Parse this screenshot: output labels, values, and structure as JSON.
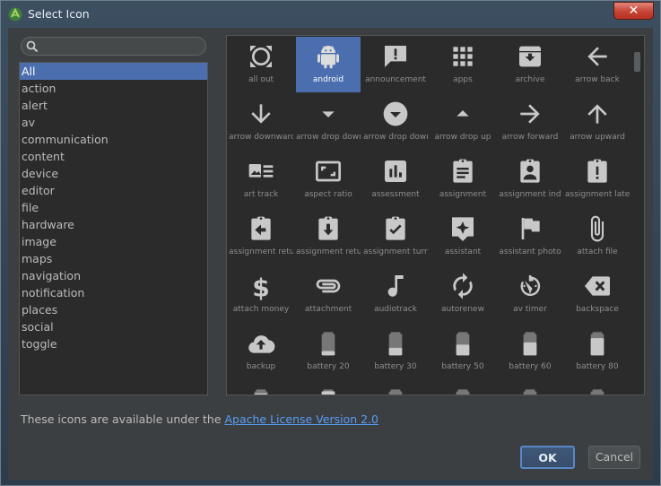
{
  "window": {
    "title": "Select Icon",
    "close_label": "✕",
    "app_icon": "android-studio-icon"
  },
  "search": {
    "value": "",
    "placeholder": ""
  },
  "categories": [
    "All",
    "action",
    "alert",
    "av",
    "communication",
    "content",
    "device",
    "editor",
    "file",
    "hardware",
    "image",
    "maps",
    "navigation",
    "notification",
    "places",
    "social",
    "toggle"
  ],
  "selected_category": "All",
  "icons": [
    {
      "label": "all out",
      "icon": "all-out-icon"
    },
    {
      "label": "android",
      "icon": "android-icon",
      "selected": true
    },
    {
      "label": "announcement",
      "icon": "announcement-icon"
    },
    {
      "label": "apps",
      "icon": "apps-icon"
    },
    {
      "label": "archive",
      "icon": "archive-icon"
    },
    {
      "label": "arrow back",
      "icon": "arrow-back-icon"
    },
    {
      "label": "arrow downward",
      "icon": "arrow-downward-icon"
    },
    {
      "label": "arrow drop down",
      "icon": "arrow-drop-down-icon"
    },
    {
      "label": "arrow drop down circle",
      "icon": "arrow-drop-down-circle-icon"
    },
    {
      "label": "arrow drop up",
      "icon": "arrow-drop-up-icon"
    },
    {
      "label": "arrow forward",
      "icon": "arrow-forward-icon"
    },
    {
      "label": "arrow upward",
      "icon": "arrow-upward-icon"
    },
    {
      "label": "art track",
      "icon": "art-track-icon"
    },
    {
      "label": "aspect ratio",
      "icon": "aspect-ratio-icon"
    },
    {
      "label": "assessment",
      "icon": "assessment-icon"
    },
    {
      "label": "assignment",
      "icon": "assignment-icon"
    },
    {
      "label": "assignment ind",
      "icon": "assignment-ind-icon"
    },
    {
      "label": "assignment late",
      "icon": "assignment-late-icon"
    },
    {
      "label": "assignment return",
      "icon": "assignment-return-icon"
    },
    {
      "label": "assignment returned",
      "icon": "assignment-returned-icon"
    },
    {
      "label": "assignment turned in",
      "icon": "assignment-turned-in-icon"
    },
    {
      "label": "assistant",
      "icon": "assistant-icon"
    },
    {
      "label": "assistant photo",
      "icon": "assistant-photo-icon"
    },
    {
      "label": "attach file",
      "icon": "attach-file-icon"
    },
    {
      "label": "attach money",
      "icon": "attach-money-icon"
    },
    {
      "label": "attachment",
      "icon": "attachment-icon"
    },
    {
      "label": "audiotrack",
      "icon": "audiotrack-icon"
    },
    {
      "label": "autorenew",
      "icon": "autorenew-icon"
    },
    {
      "label": "av timer",
      "icon": "av-timer-icon"
    },
    {
      "label": "backspace",
      "icon": "backspace-icon"
    },
    {
      "label": "backup",
      "icon": "backup-icon"
    },
    {
      "label": "battery 20",
      "icon": "battery-20-icon"
    },
    {
      "label": "battery 30",
      "icon": "battery-30-icon"
    },
    {
      "label": "battery 50",
      "icon": "battery-50-icon"
    },
    {
      "label": "battery 60",
      "icon": "battery-60-icon"
    },
    {
      "label": "battery 80",
      "icon": "battery-80-icon"
    },
    {
      "label": "",
      "icon": "battery-90-icon"
    },
    {
      "label": "",
      "icon": "battery-alert-icon"
    },
    {
      "label": "",
      "icon": "battery-charging-20-icon"
    },
    {
      "label": "",
      "icon": "battery-charging-30-icon"
    },
    {
      "label": "",
      "icon": "battery-charging-50-icon"
    },
    {
      "label": "",
      "icon": "battery-charging-60-icon"
    }
  ],
  "license": {
    "prefix": "These icons are available under the ",
    "link": "Apache License Version 2.0"
  },
  "buttons": {
    "ok": "OK",
    "cancel": "Cancel"
  },
  "colors": {
    "selection": "#4b6eaf",
    "link": "#589df6",
    "close": "#c64434",
    "panel": "#2b2b2b",
    "background": "#3c3f41"
  }
}
